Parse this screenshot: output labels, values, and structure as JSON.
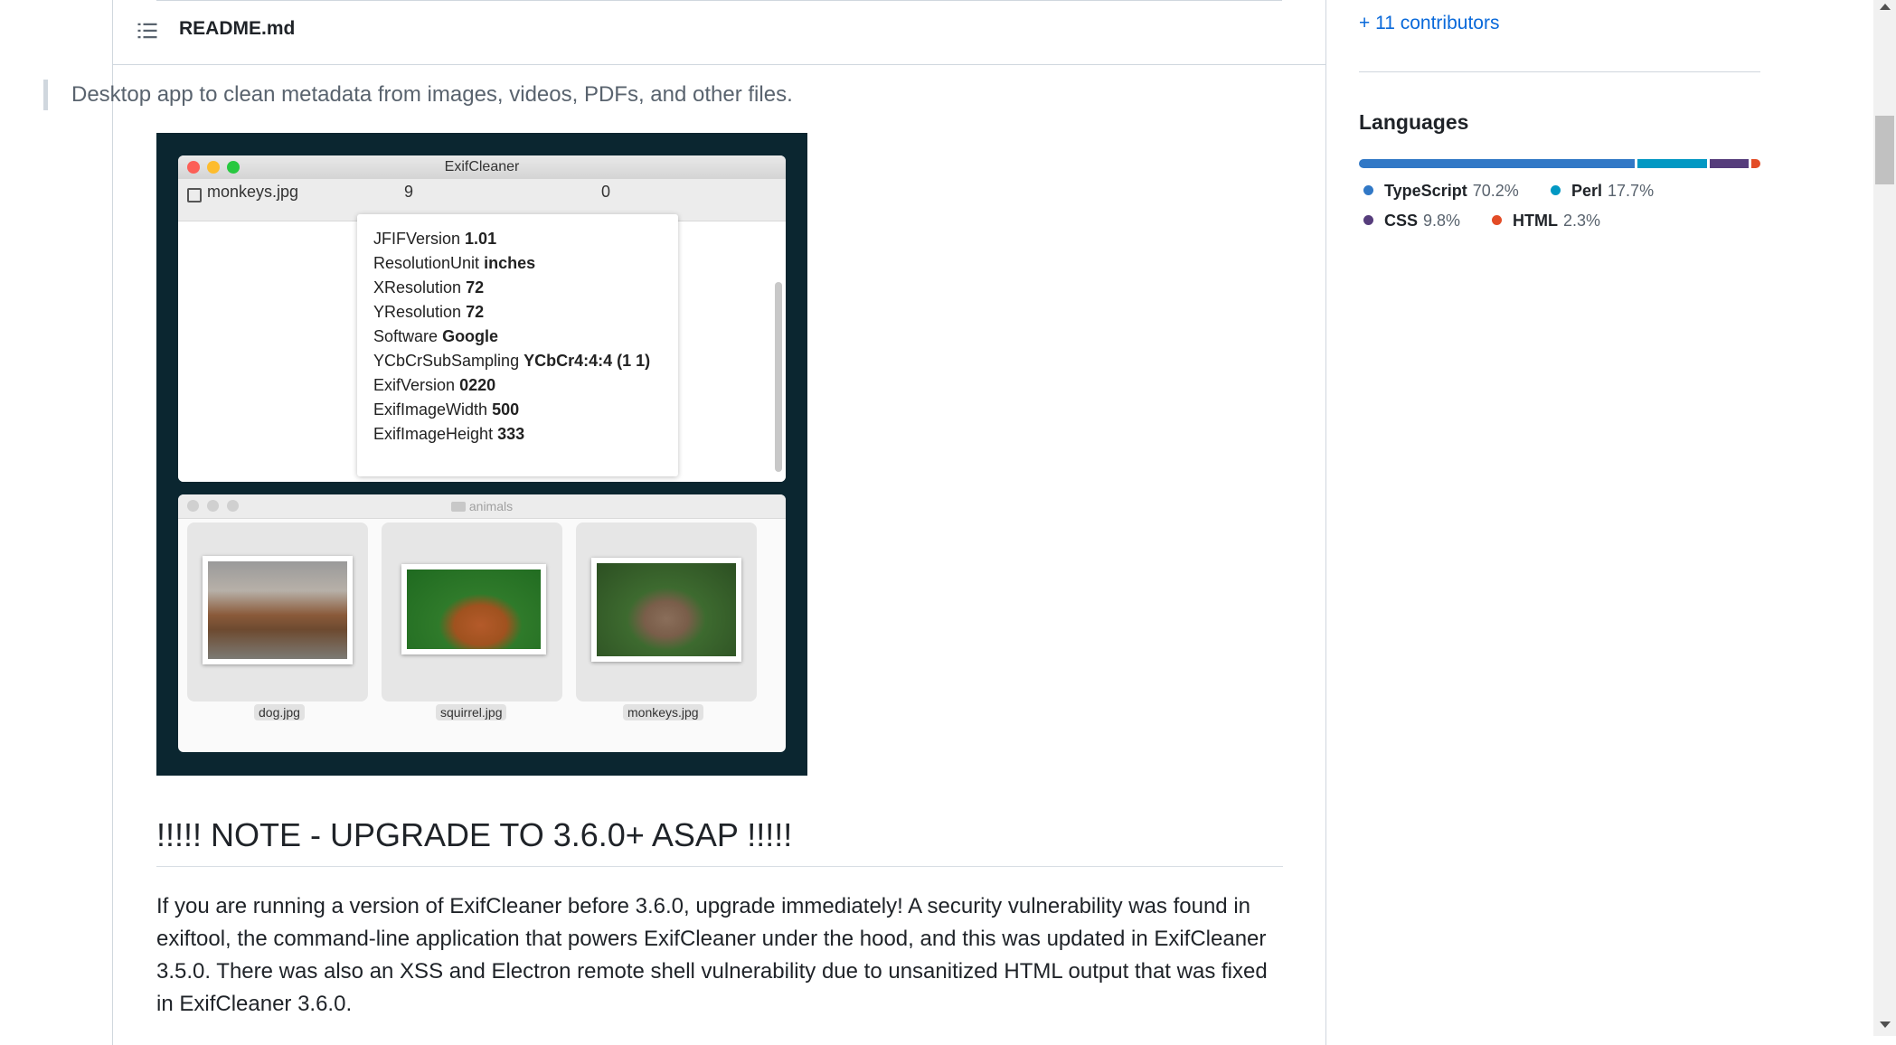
{
  "readme": {
    "filename": "README.md",
    "blockquote": "Desktop app to clean metadata from images, videos, PDFs, and other files."
  },
  "demo": {
    "window_title": "ExifCleaner",
    "file_name": "monkeys.jpg",
    "count_before": "9",
    "count_after": "0",
    "metadata": [
      {
        "key": "JFIFVersion",
        "value": "1.01"
      },
      {
        "key": "ResolutionUnit",
        "value": "inches"
      },
      {
        "key": "XResolution",
        "value": "72"
      },
      {
        "key": "YResolution",
        "value": "72"
      },
      {
        "key": "Software",
        "value": "Google"
      },
      {
        "key": "YCbCrSubSampling",
        "value": "YCbCr4:4:4 (1 1)"
      },
      {
        "key": "ExifVersion",
        "value": "0220"
      },
      {
        "key": "ExifImageWidth",
        "value": "500"
      },
      {
        "key": "ExifImageHeight",
        "value": "333"
      }
    ],
    "finder_title": "animals",
    "files": [
      "dog.jpg",
      "squirrel.jpg",
      "monkeys.jpg"
    ]
  },
  "note": {
    "heading": "!!!!! NOTE - UPGRADE TO 3.6.0+ ASAP !!!!!",
    "paragraph": "If you are running a version of ExifCleaner before 3.6.0, upgrade immediately! A security vulnerability was found in exiftool, the command-line application that powers ExifCleaner under the hood, and this was updated in ExifCleaner 3.5.0. There was also an XSS and Electron remote shell vulnerability due to unsanitized HTML output that was fixed in ExifCleaner 3.6.0."
  },
  "sidebar": {
    "contributors_link": "+ 11 contributors",
    "languages_heading": "Languages",
    "languages": [
      {
        "name": "TypeScript",
        "percent": "70.2%",
        "value": 70.2,
        "color": "#3178c6"
      },
      {
        "name": "Perl",
        "percent": "17.7%",
        "value": 17.7,
        "color": "#0298c3"
      },
      {
        "name": "CSS",
        "percent": "9.8%",
        "value": 9.8,
        "color": "#563d7c"
      },
      {
        "name": "HTML",
        "percent": "2.3%",
        "value": 2.3,
        "color": "#e34c26"
      }
    ]
  },
  "icons": {
    "toc": "list-unordered-icon",
    "file": "image-file-icon",
    "folder": "folder-icon"
  }
}
